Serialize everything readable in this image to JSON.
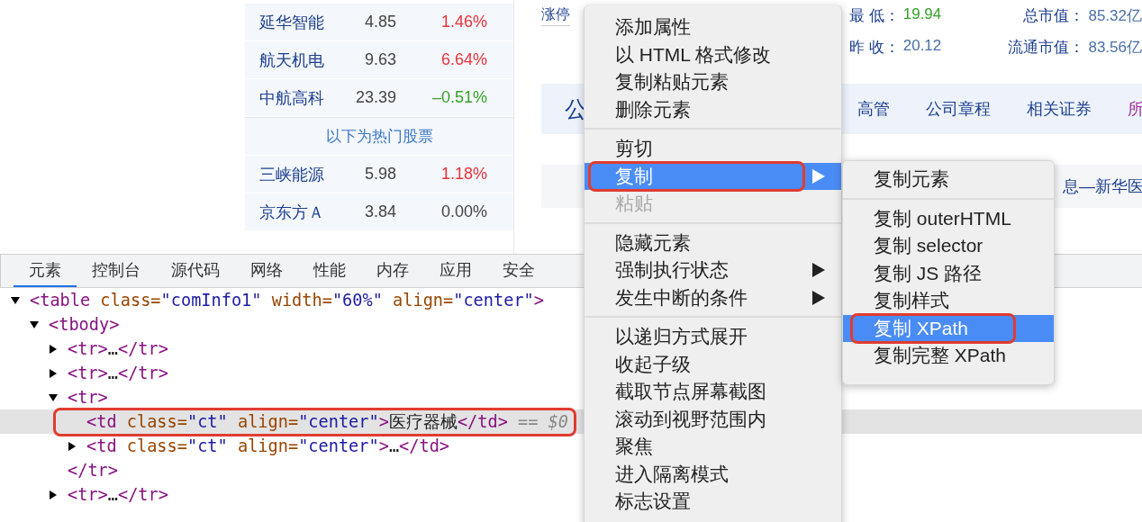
{
  "stock_list": [
    {
      "kind": "stock",
      "name": "延华智能",
      "price": "4.85",
      "change": "1.46%",
      "color": "#e8333a"
    },
    {
      "kind": "stock",
      "name": "航天机电",
      "price": "9.63",
      "change": "6.64%",
      "color": "#e8333a"
    },
    {
      "kind": "stock",
      "name": "中航高科",
      "price": "23.39",
      "change": "–0.51%",
      "color": "#36a02a"
    },
    {
      "kind": "heading",
      "name": "以下为热门股票"
    },
    {
      "kind": "stock",
      "name": "三峡能源",
      "price": "5.98",
      "change": "1.18%",
      "color": "#e8333a"
    },
    {
      "kind": "stock",
      "name": "京东方Ａ",
      "price": "3.84",
      "change": "0.00%",
      "color": "#444444"
    }
  ],
  "quote": {
    "link": "涨停",
    "stats": [
      {
        "label": "最 低：",
        "value": "19.94",
        "color": "#36a02a"
      },
      {
        "label": "总市值：",
        "value": "85.32亿",
        "color": "#4a6fa8"
      },
      {
        "label": "昨 收：",
        "value": "20.12",
        "color": "#4a6fa8"
      },
      {
        "label": "流通市值：",
        "value": "83.56亿",
        "color": "#4a6fa8"
      }
    ]
  },
  "company_nav": {
    "title": "公",
    "links": [
      {
        "label": "高管",
        "visited": false
      },
      {
        "label": "公司章程",
        "visited": false
      },
      {
        "label": "相关证券",
        "visited": false
      },
      {
        "label": "所",
        "visited": true
      }
    ]
  },
  "news_bar": {
    "text": "息—新华医"
  },
  "devtools": {
    "tabs": [
      {
        "label": "元素",
        "selected": true
      },
      {
        "label": "控制台",
        "selected": false
      },
      {
        "label": "源代码",
        "selected": false
      },
      {
        "label": "网络",
        "selected": false
      },
      {
        "label": "性能",
        "selected": false
      },
      {
        "label": "内存",
        "selected": false
      },
      {
        "label": "应用",
        "selected": false
      },
      {
        "label": "安全",
        "selected": false
      }
    ],
    "dom_tree": [
      {
        "selected": false,
        "annotated": false,
        "expanded": true,
        "parts": [
          {
            "kind": "tag",
            "text": "<table"
          },
          {
            "kind": "attr",
            "text": " class="
          },
          {
            "kind": "value",
            "text": "\"comInfo1\""
          },
          {
            "kind": "attr",
            "text": " width="
          },
          {
            "kind": "value",
            "text": "\"60%\""
          },
          {
            "kind": "attr",
            "text": " align="
          },
          {
            "kind": "value",
            "text": "\"center\""
          },
          {
            "kind": "tag",
            "text": ">"
          }
        ],
        "children": [
          {
            "selected": false,
            "annotated": false,
            "expanded": true,
            "parts": [
              {
                "kind": "tag",
                "text": "<tbody>"
              }
            ],
            "children": [
              {
                "selected": false,
                "annotated": false,
                "expanded": false,
                "parts": [
                  {
                    "kind": "tag",
                    "text": "<tr>"
                  },
                  {
                    "kind": "text",
                    "text": "…"
                  },
                  {
                    "kind": "tag",
                    "text": "</tr>"
                  }
                ]
              },
              {
                "selected": false,
                "annotated": false,
                "expanded": false,
                "parts": [
                  {
                    "kind": "tag",
                    "text": "<tr>"
                  },
                  {
                    "kind": "text",
                    "text": "…"
                  },
                  {
                    "kind": "tag",
                    "text": "</tr>"
                  }
                ]
              },
              {
                "selected": false,
                "annotated": false,
                "expanded": true,
                "parts": [
                  {
                    "kind": "tag",
                    "text": "<tr>"
                  }
                ],
                "children": [
                  {
                    "selected": true,
                    "annotated": true,
                    "parts": [
                      {
                        "kind": "tag",
                        "text": "<td"
                      },
                      {
                        "kind": "attr",
                        "text": " class="
                      },
                      {
                        "kind": "value",
                        "text": "\"ct\""
                      },
                      {
                        "kind": "attr",
                        "text": " align="
                      },
                      {
                        "kind": "value",
                        "text": "\"center\""
                      },
                      {
                        "kind": "tag",
                        "text": ">"
                      },
                      {
                        "kind": "text",
                        "text": "医疗器械"
                      },
                      {
                        "kind": "tag",
                        "text": "</td>"
                      },
                      {
                        "kind": "marker",
                        "text": " == $0"
                      }
                    ]
                  },
                  {
                    "selected": false,
                    "annotated": false,
                    "expanded": false,
                    "parts": [
                      {
                        "kind": "tag",
                        "text": "<td"
                      },
                      {
                        "kind": "attr",
                        "text": " class="
                      },
                      {
                        "kind": "value",
                        "text": "\"ct\""
                      },
                      {
                        "kind": "attr",
                        "text": " align="
                      },
                      {
                        "kind": "value",
                        "text": "\"center\""
                      },
                      {
                        "kind": "tag",
                        "text": ">"
                      },
                      {
                        "kind": "text",
                        "text": "…"
                      },
                      {
                        "kind": "tag",
                        "text": "</td>"
                      }
                    ]
                  }
                ],
                "close": [
                  {
                    "kind": "tag",
                    "text": "</tr>"
                  }
                ]
              },
              {
                "selected": false,
                "annotated": false,
                "expanded": false,
                "parts": [
                  {
                    "kind": "tag",
                    "text": "<tr>"
                  },
                  {
                    "kind": "text",
                    "text": "…"
                  },
                  {
                    "kind": "tag",
                    "text": "</tr>"
                  }
                ]
              }
            ]
          }
        ]
      }
    ]
  },
  "context_menu": {
    "groups": [
      [
        {
          "label": "添加属性",
          "selected": false,
          "disabled": false,
          "has_submenu": false,
          "annotated": false
        },
        {
          "label": "以 HTML 格式修改",
          "selected": false,
          "disabled": false,
          "has_submenu": false,
          "annotated": false
        },
        {
          "label": "复制粘贴元素",
          "selected": false,
          "disabled": false,
          "has_submenu": false,
          "annotated": false
        },
        {
          "label": "删除元素",
          "selected": false,
          "disabled": false,
          "has_submenu": false,
          "annotated": false
        }
      ],
      [
        {
          "label": "剪切",
          "selected": false,
          "disabled": false,
          "has_submenu": false,
          "annotated": false
        },
        {
          "label": "复制",
          "selected": true,
          "disabled": false,
          "has_submenu": true,
          "annotated": true
        },
        {
          "label": "粘贴",
          "selected": false,
          "disabled": true,
          "has_submenu": false,
          "annotated": false
        }
      ],
      [
        {
          "label": "隐藏元素",
          "selected": false,
          "disabled": false,
          "has_submenu": false,
          "annotated": false
        },
        {
          "label": "强制执行状态",
          "selected": false,
          "disabled": false,
          "has_submenu": true,
          "annotated": false
        },
        {
          "label": "发生中断的条件",
          "selected": false,
          "disabled": false,
          "has_submenu": true,
          "annotated": false
        }
      ],
      [
        {
          "label": "以递归方式展开",
          "selected": false,
          "disabled": false,
          "has_submenu": false,
          "annotated": false
        },
        {
          "label": "收起子级",
          "selected": false,
          "disabled": false,
          "has_submenu": false,
          "annotated": false
        },
        {
          "label": "截取节点屏幕截图",
          "selected": false,
          "disabled": false,
          "has_submenu": false,
          "annotated": false
        },
        {
          "label": "滚动到视野范围内",
          "selected": false,
          "disabled": false,
          "has_submenu": false,
          "annotated": false
        },
        {
          "label": "聚焦",
          "selected": false,
          "disabled": false,
          "has_submenu": false,
          "annotated": false
        },
        {
          "label": "进入隔离模式",
          "selected": false,
          "disabled": false,
          "has_submenu": false,
          "annotated": false
        },
        {
          "label": "标志设置",
          "selected": false,
          "disabled": false,
          "has_submenu": false,
          "annotated": false
        }
      ]
    ]
  },
  "submenu": {
    "groups": [
      [
        {
          "label": "复制元素",
          "selected": false,
          "annotated": false
        }
      ],
      [
        {
          "label": "复制 outerHTML",
          "selected": false,
          "annotated": false
        },
        {
          "label": "复制 selector",
          "selected": false,
          "annotated": false
        },
        {
          "label": "复制 JS 路径",
          "selected": false,
          "annotated": false
        },
        {
          "label": "复制样式",
          "selected": false,
          "annotated": false
        },
        {
          "label": "复制 XPath",
          "selected": true,
          "annotated": true
        },
        {
          "label": "复制完整 XPath",
          "selected": false,
          "annotated": false
        }
      ]
    ]
  }
}
